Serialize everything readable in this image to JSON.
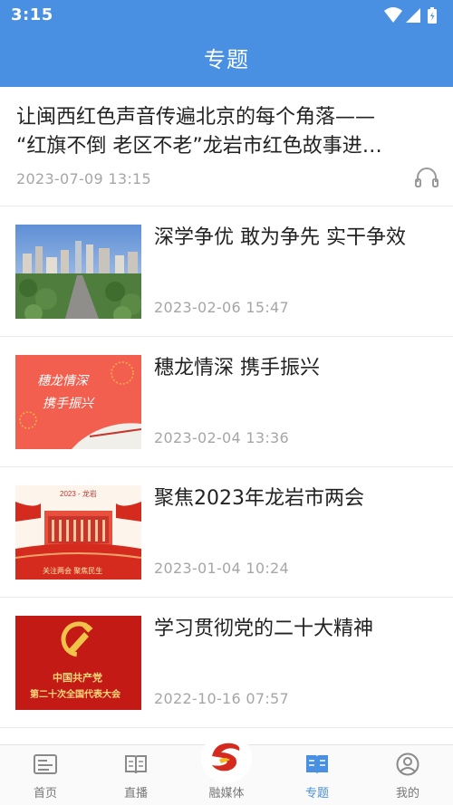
{
  "status_bar": {
    "time": "3:15"
  },
  "header": {
    "title": "专题"
  },
  "featured": {
    "title_line1": "让闽西红色声音传遍北京的每个角落——",
    "title_line2": "“红旗不倒 老区不老”龙岩市红色故事进…",
    "date": "2023-07-09  13:15",
    "icon": "headphone-icon"
  },
  "items": [
    {
      "title": "深学争优  敢为争先  实干争效",
      "date": "2023-02-06  15:47"
    },
    {
      "title": "穗龙情深  携手振兴",
      "date": "2023-02-04  13:36",
      "thumb_text": [
        "穗龙情深",
        "携手振兴"
      ]
    },
    {
      "title": "聚焦2023年龙岩市两会",
      "date": "2023-01-04  10:24",
      "thumb_text": [
        "2023 - 龙岩",
        "关注两会  聚焦民生"
      ]
    },
    {
      "title": "学习贯彻党的二十大精神",
      "date": "2022-10-16  07:57",
      "thumb_text": [
        "中国共产党",
        "第二十次全国代表大会"
      ]
    }
  ],
  "bottom_nav": [
    {
      "label": "首页",
      "icon": "news-icon"
    },
    {
      "label": "直播",
      "icon": "book-icon"
    },
    {
      "label": "融媒体",
      "icon": "media-logo-icon"
    },
    {
      "label": "专题",
      "icon": "topic-book-icon",
      "active": true
    },
    {
      "label": "我的",
      "icon": "user-icon"
    }
  ],
  "colors": {
    "primary": "#4a90e2",
    "date_gray": "#a6a6a6",
    "red": "#d52b1e"
  }
}
